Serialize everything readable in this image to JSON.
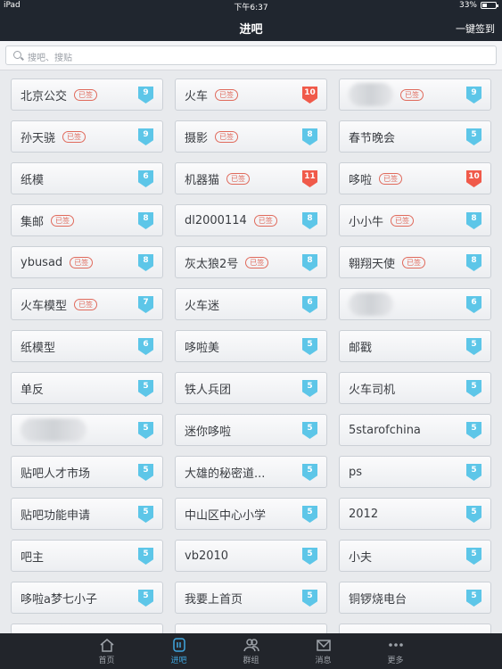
{
  "statusbar": {
    "device": "iPad",
    "time": "下午6:37",
    "battery": "33%",
    "battery_level": 0.33
  },
  "navbar": {
    "title": "进吧",
    "signin_label": "一键签到"
  },
  "search": {
    "placeholder": "搜吧、搜贴"
  },
  "forums": [
    {
      "name": "北京公交",
      "signed": "已签",
      "level": "9",
      "level_color": "blue"
    },
    {
      "name": "火车",
      "signed": "已签",
      "level": "10",
      "level_color": "red"
    },
    {
      "name": "",
      "blurred": true,
      "signed": "已签",
      "level": "9",
      "level_color": "blue"
    },
    {
      "name": "孙天骁",
      "signed": "已签",
      "level": "9",
      "level_color": "blue"
    },
    {
      "name": "摄影",
      "signed": "已签",
      "level": "8",
      "level_color": "blue"
    },
    {
      "name": "春节晚会",
      "signed": "",
      "level": "5",
      "level_color": "blue"
    },
    {
      "name": "纸模",
      "signed": "",
      "level": "6",
      "level_color": "blue"
    },
    {
      "name": "机器猫",
      "signed": "已签",
      "level": "11",
      "level_color": "red"
    },
    {
      "name": "哆啦",
      "signed": "已签",
      "level": "10",
      "level_color": "red"
    },
    {
      "name": "集邮",
      "signed": "已签",
      "level": "8",
      "level_color": "blue"
    },
    {
      "name": "dl2000114",
      "signed": "已签",
      "level": "8",
      "level_color": "blue"
    },
    {
      "name": "小小牛",
      "signed": "已签",
      "level": "8",
      "level_color": "blue"
    },
    {
      "name": "ybusad",
      "signed": "已签",
      "level": "8",
      "level_color": "blue"
    },
    {
      "name": "灰太狼2号",
      "signed": "已签",
      "level": "8",
      "level_color": "blue"
    },
    {
      "name": "翱翔天使",
      "signed": "已签",
      "level": "8",
      "level_color": "blue"
    },
    {
      "name": "火车模型",
      "signed": "已签",
      "level": "7",
      "level_color": "blue"
    },
    {
      "name": "火车迷",
      "signed": "",
      "level": "6",
      "level_color": "blue"
    },
    {
      "name": "",
      "blurred": true,
      "signed": "",
      "level": "6",
      "level_color": "blue"
    },
    {
      "name": "纸模型",
      "signed": "",
      "level": "6",
      "level_color": "blue"
    },
    {
      "name": "哆啦美",
      "signed": "",
      "level": "5",
      "level_color": "blue"
    },
    {
      "name": "邮戳",
      "signed": "",
      "level": "5",
      "level_color": "blue"
    },
    {
      "name": "单反",
      "signed": "",
      "level": "5",
      "level_color": "blue"
    },
    {
      "name": "铁人兵团",
      "signed": "",
      "level": "5",
      "level_color": "blue"
    },
    {
      "name": "火车司机",
      "signed": "",
      "level": "5",
      "level_color": "blue"
    },
    {
      "name": "",
      "blurred": true,
      "signed": "",
      "level": "5",
      "level_color": "blue"
    },
    {
      "name": "迷你哆啦",
      "signed": "",
      "level": "5",
      "level_color": "blue"
    },
    {
      "name": "5starofchina",
      "signed": "",
      "level": "5",
      "level_color": "blue"
    },
    {
      "name": "贴吧人才市场",
      "signed": "",
      "level": "5",
      "level_color": "blue"
    },
    {
      "name": "大雄的秘密道...",
      "signed": "",
      "level": "5",
      "level_color": "blue"
    },
    {
      "name": "ps",
      "signed": "",
      "level": "5",
      "level_color": "blue"
    },
    {
      "name": "贴吧功能申请",
      "signed": "",
      "level": "5",
      "level_color": "blue"
    },
    {
      "name": "中山区中心小学",
      "signed": "",
      "level": "5",
      "level_color": "blue"
    },
    {
      "name": "2012",
      "signed": "",
      "level": "5",
      "level_color": "blue"
    },
    {
      "name": "吧主",
      "signed": "",
      "level": "5",
      "level_color": "blue"
    },
    {
      "name": "vb2010",
      "signed": "",
      "level": "5",
      "level_color": "blue"
    },
    {
      "name": "小夫",
      "signed": "",
      "level": "5",
      "level_color": "blue"
    },
    {
      "name": "哆啦a梦七小子",
      "signed": "",
      "level": "5",
      "level_color": "blue"
    },
    {
      "name": "我要上首页",
      "signed": "",
      "level": "5",
      "level_color": "blue"
    },
    {
      "name": "铜锣烧电台",
      "signed": "",
      "level": "5",
      "level_color": "blue"
    },
    {
      "name": "",
      "signed": "",
      "level": "",
      "level_color": "blue"
    },
    {
      "name": "",
      "signed": "",
      "level": "",
      "level_color": "blue"
    },
    {
      "name": "",
      "signed": "",
      "level": "",
      "level_color": "blue"
    }
  ],
  "colors": {
    "bar": "#20262f",
    "level_blue": "#5dc6e8",
    "level_red": "#f05a4a",
    "tag_red": "#e06a5c",
    "tab_active": "#3fa7e0"
  },
  "tabbar": {
    "tabs": [
      {
        "label": "首页",
        "icon": "home-icon",
        "active": false
      },
      {
        "label": "进吧",
        "icon": "enter-forum-icon",
        "active": true
      },
      {
        "label": "群组",
        "icon": "group-icon",
        "active": false
      },
      {
        "label": "消息",
        "icon": "message-icon",
        "active": false
      },
      {
        "label": "更多",
        "icon": "more-icon",
        "active": false
      }
    ]
  }
}
